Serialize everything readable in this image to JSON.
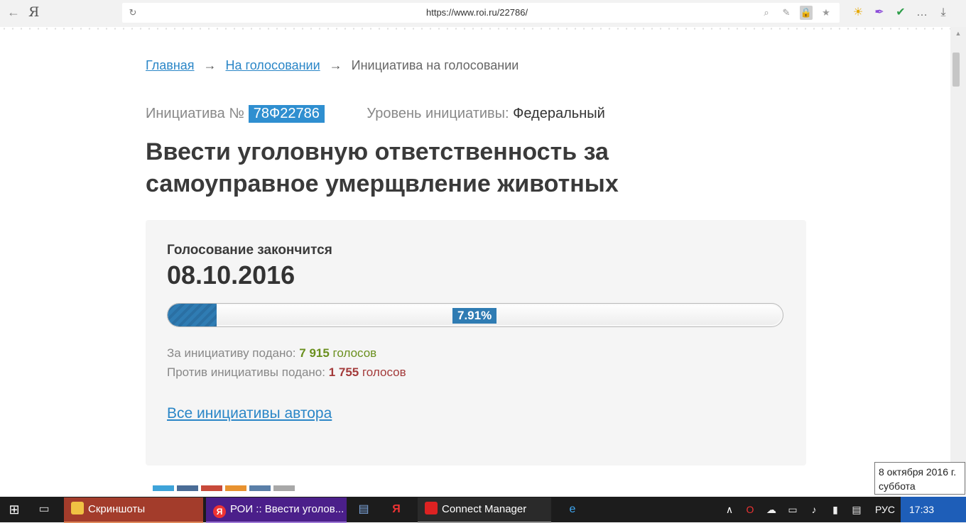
{
  "browser": {
    "back_glyph": "←",
    "logo": "Я",
    "reload_glyph": "↻",
    "url": "https://www.roi.ru/22786/",
    "tools": [
      "⌕",
      "✎",
      "🔒",
      "★"
    ],
    "extensions": [
      "☀",
      "✒",
      "✔",
      "…",
      "⤓"
    ]
  },
  "breadcrumb": {
    "home": "Главная",
    "arrow": "→",
    "voting": "На голосовании",
    "current": "Инициатива на голосовании"
  },
  "initiative": {
    "number_label": "Инициатива №",
    "number": "78Ф22786",
    "level_label": "Уровень инициативы:",
    "level_value": "Федеральный",
    "title": "Ввести уголовную ответственность за самоуправное умерщвление животных"
  },
  "voting": {
    "ends_label": "Голосование закончится",
    "ends_date": "08.10.2016",
    "progress_percent": 7.91,
    "progress_label": "7.91%",
    "for_label": "За инициативу подано:",
    "for_count": "7 915",
    "for_word": "голосов",
    "against_label": "Против инициативы подано:",
    "against_count": "1 755",
    "against_word": "голосов",
    "author_link": "Все инициативы автора"
  },
  "colors": {
    "accent": "#2f8fd0",
    "progress": "#2f7cb3",
    "for": "#6a8f1e",
    "against": "#a33a3a",
    "share": [
      "#3ea3d9",
      "#4a6c96",
      "#c84a3a",
      "#e8922f",
      "#5a7fa8",
      "#a8a8a8"
    ]
  },
  "taskbar": {
    "start_glyph": "⊞",
    "taskview_glyph": "▭",
    "screens_label": "Скриншоты",
    "roi_icon": "Я",
    "roi_label": "РОИ :: Ввести уголов...",
    "word_glyph": "▤",
    "yandex_glyph": "Я",
    "connect_label": "Connect Manager",
    "ie_glyph": "e",
    "tray_chevron": "∧",
    "tray": [
      "O",
      "☁",
      "▭",
      "♪",
      "▮",
      "▤"
    ],
    "lang": "РУС",
    "time": "17:33"
  },
  "tooltip": {
    "date": "8 октября 2016 г.",
    "weekday": "суббота"
  }
}
